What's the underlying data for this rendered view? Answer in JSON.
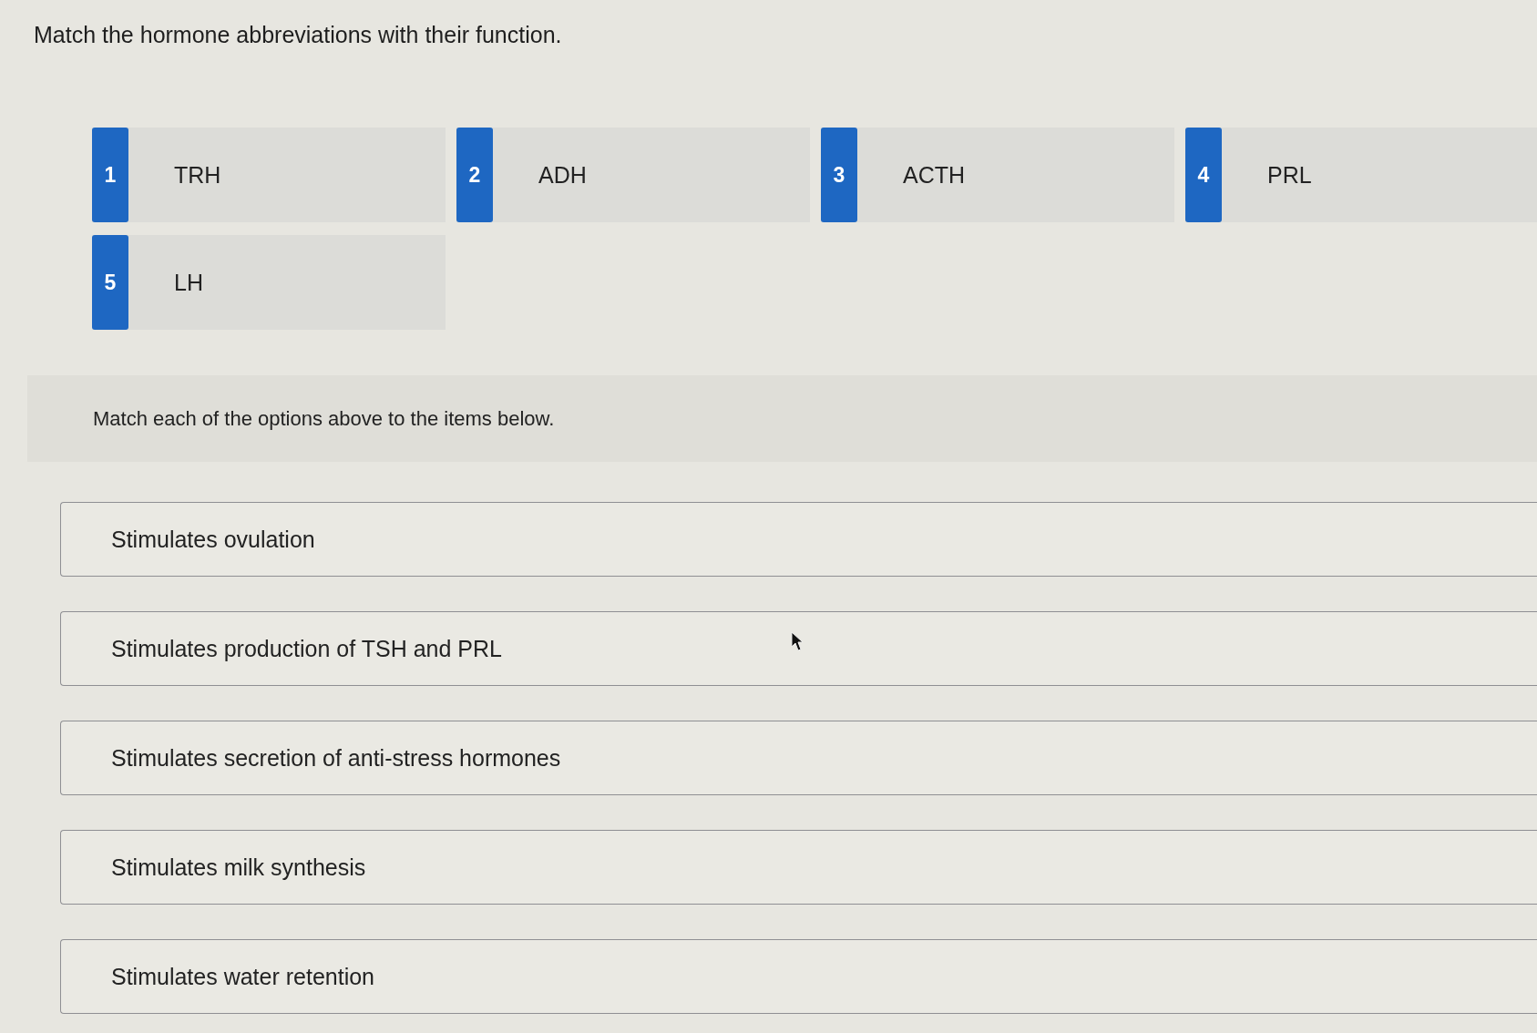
{
  "question": {
    "title": "Match the hormone abbreviations with their function."
  },
  "options": [
    {
      "number": "1",
      "label": "TRH"
    },
    {
      "number": "2",
      "label": "ADH"
    },
    {
      "number": "3",
      "label": "ACTH"
    },
    {
      "number": "4",
      "label": "PRL"
    },
    {
      "number": "5",
      "label": "LH"
    }
  ],
  "instructions": "Match each of the options above to the items below.",
  "targets": [
    {
      "label": "Stimulates ovulation"
    },
    {
      "label": "Stimulates production of TSH and PRL"
    },
    {
      "label": "Stimulates secretion of anti-stress hormones"
    },
    {
      "label": "Stimulates milk synthesis"
    },
    {
      "label": "Stimulates water retention"
    }
  ]
}
